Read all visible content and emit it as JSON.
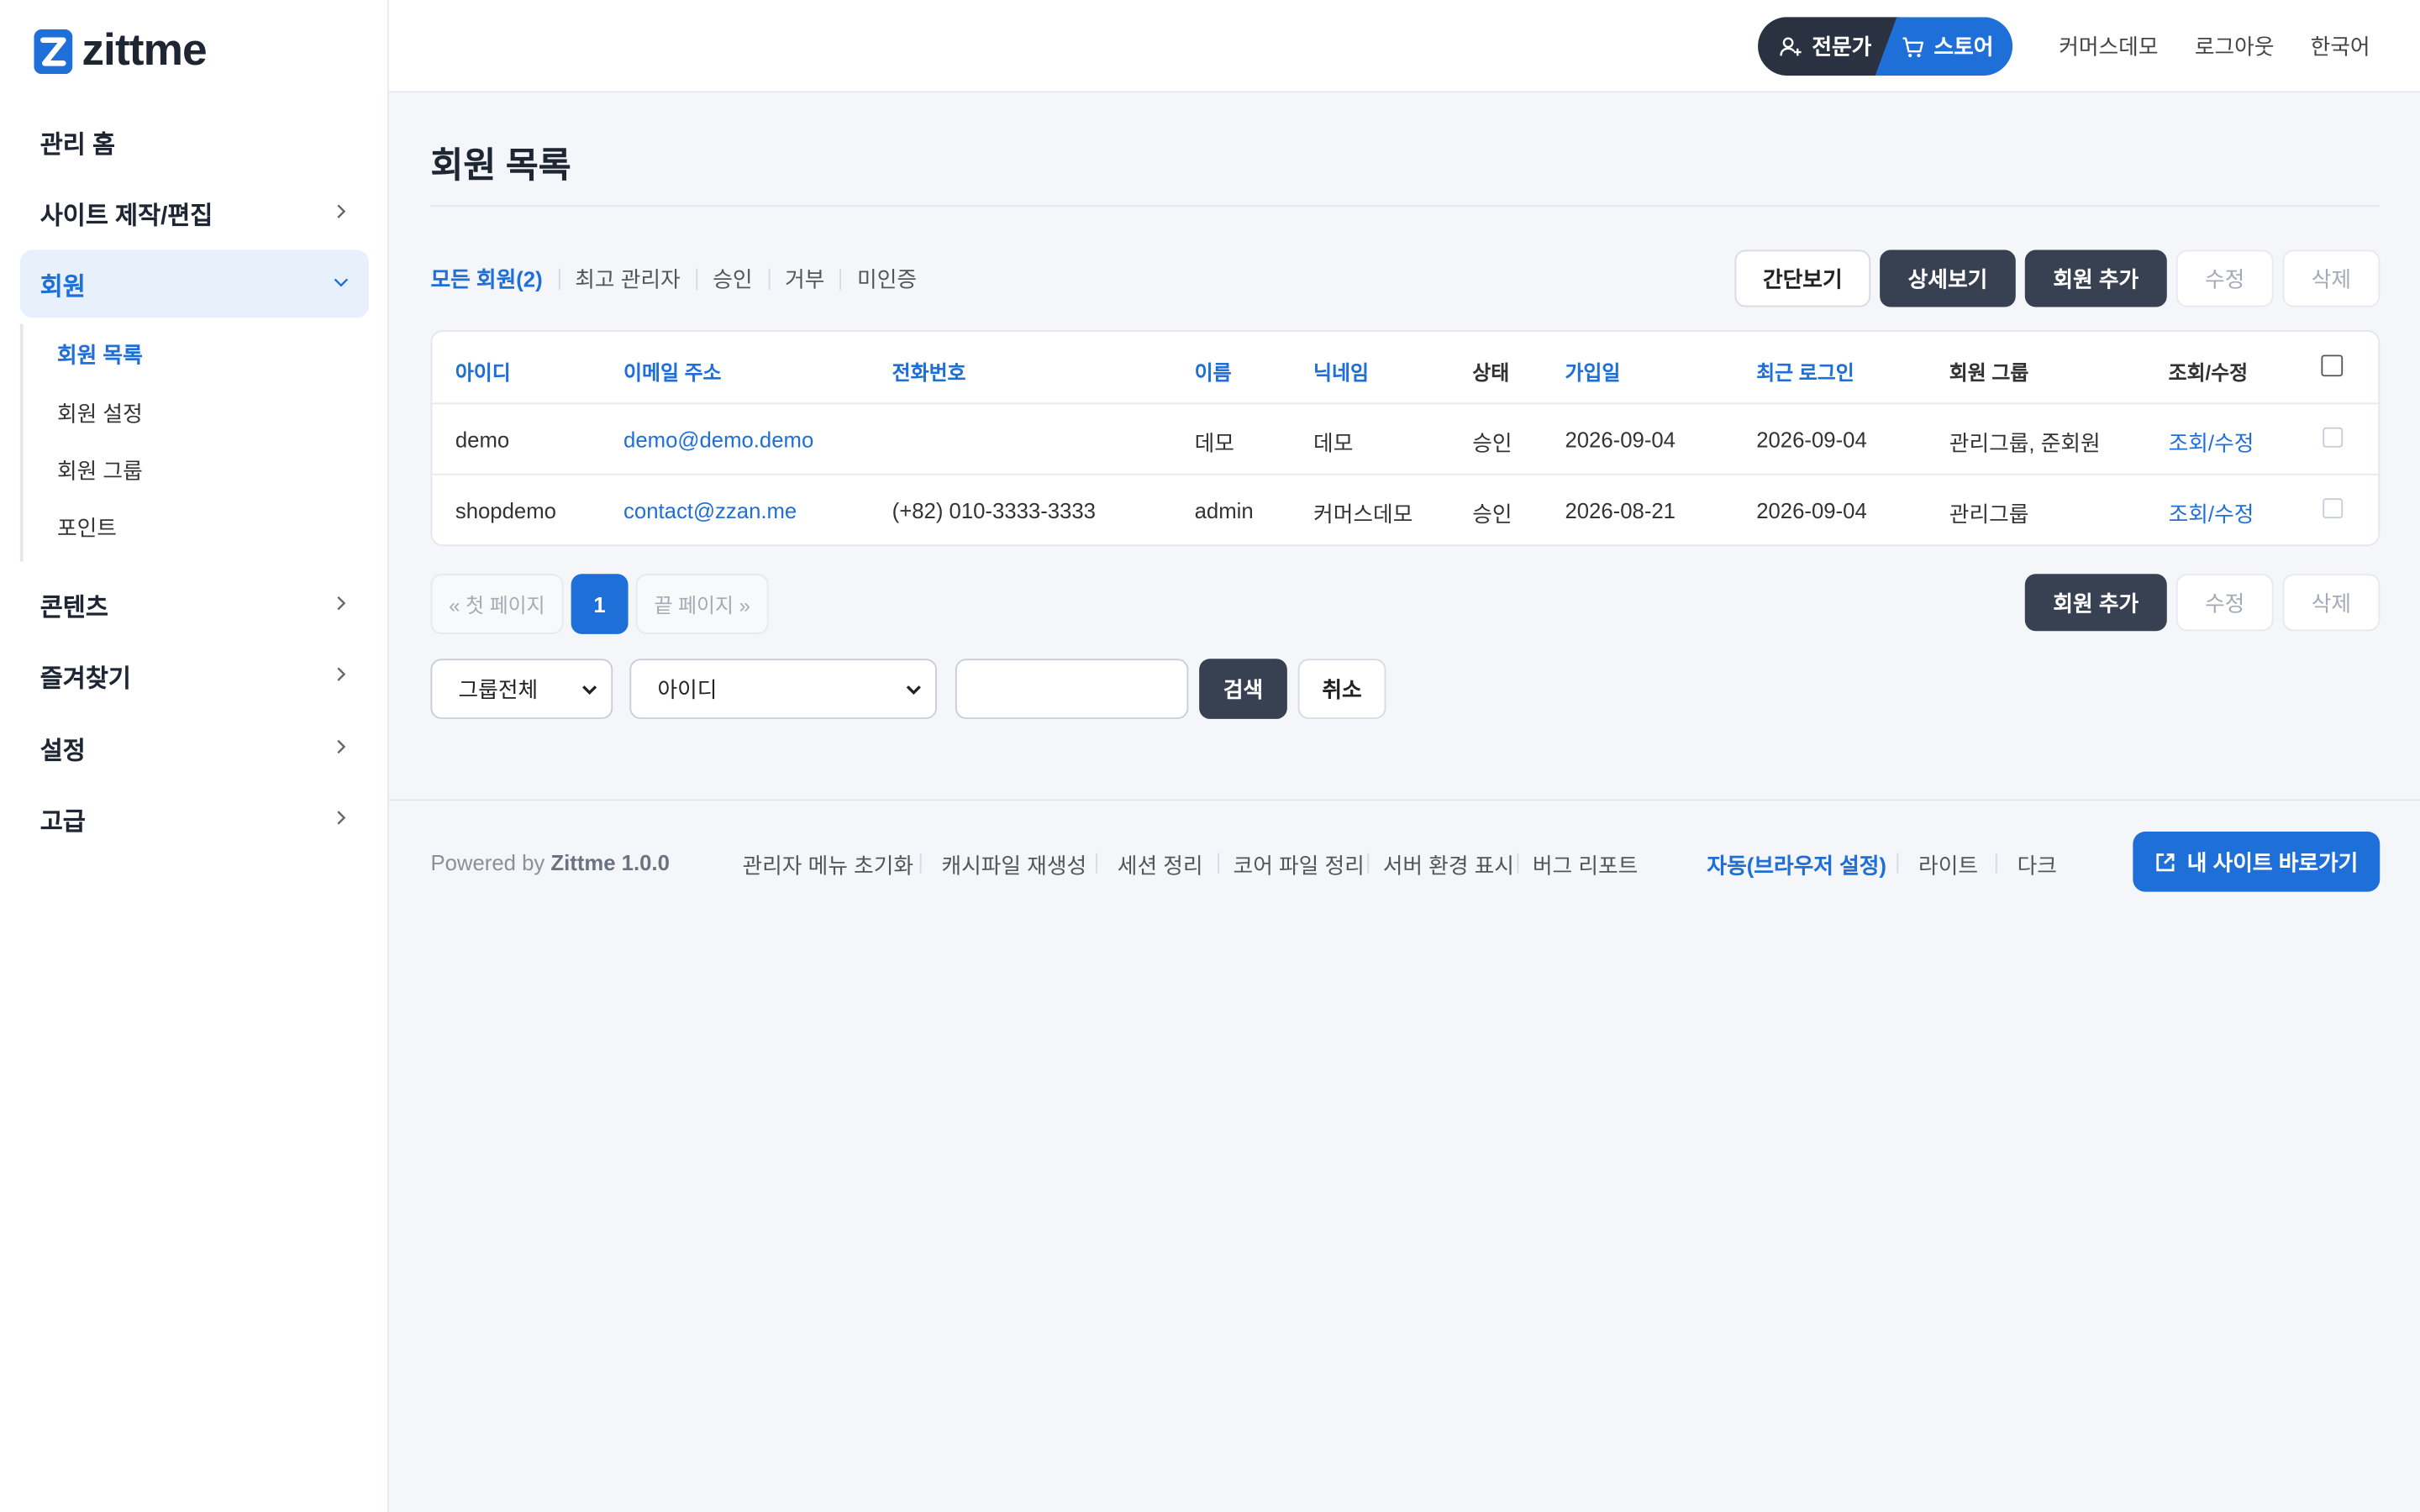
{
  "brand": {
    "name": "zittme",
    "accent": "#1f6fd8",
    "dark": "#2a3140"
  },
  "sidebar": {
    "items": [
      {
        "label": "관리 홈"
      },
      {
        "label": "사이트 제작/편집"
      },
      {
        "label": "회원"
      },
      {
        "label": "콘텐츠"
      },
      {
        "label": "즐겨찾기"
      },
      {
        "label": "설정"
      },
      {
        "label": "고급"
      }
    ],
    "submenu": [
      {
        "label": "회원 목록"
      },
      {
        "label": "회원 설정"
      },
      {
        "label": "회원 그룹"
      },
      {
        "label": "포인트"
      }
    ]
  },
  "header": {
    "expert_label": "전문가",
    "store_label": "스토어",
    "links": [
      "커머스데모",
      "로그아웃",
      "한국어"
    ]
  },
  "main": {
    "title": "회원 목록",
    "filters": [
      "모든 회원(2)",
      "최고 관리자",
      "승인",
      "거부",
      "미인증"
    ],
    "buttons": {
      "simple": "간단보기",
      "detail": "상세보기",
      "add": "회원 추가",
      "edit": "수정",
      "delete": "삭제"
    },
    "table": {
      "headers": [
        "아이디",
        "이메일 주소",
        "전화번호",
        "이름",
        "닉네임",
        "상태",
        "가입일",
        "최근 로그인",
        "회원 그룹",
        "조회/수정"
      ],
      "rows": [
        {
          "id": "demo",
          "email": "demo@demo.demo",
          "phone": "",
          "name": "데모",
          "nickname": "데모",
          "status": "승인",
          "joined": "2026-09-04",
          "last_login": "2026-09-04",
          "group": "관리그룹, 준회원",
          "action": "조회/수정"
        },
        {
          "id": "shopdemo",
          "email": "contact@zzan.me",
          "phone": "(+82) 010-3333-3333",
          "name": "admin",
          "nickname": "커머스데모",
          "status": "승인",
          "joined": "2026-08-21",
          "last_login": "2026-09-04",
          "group": "관리그룹",
          "action": "조회/수정"
        }
      ]
    },
    "pagination": {
      "first": "« 첫 페이지",
      "current": "1",
      "last": "끝 페이지 »"
    },
    "search": {
      "group_select": "그룹전체",
      "field_select": "아이디",
      "query": "",
      "search_btn": "검색",
      "cancel_btn": "취소"
    }
  },
  "footer": {
    "powered_prefix": "Powered by ",
    "powered_product": "Zittme 1.0.0",
    "links": [
      "관리자 메뉴 초기화",
      "캐시파일 재생성",
      "세션 정리",
      "코어 파일 정리",
      "서버 환경 표시",
      "버그 리포트"
    ],
    "themes": [
      "자동(브라우저 설정)",
      "라이트",
      "다크"
    ],
    "cta": "내 사이트 바로가기"
  }
}
